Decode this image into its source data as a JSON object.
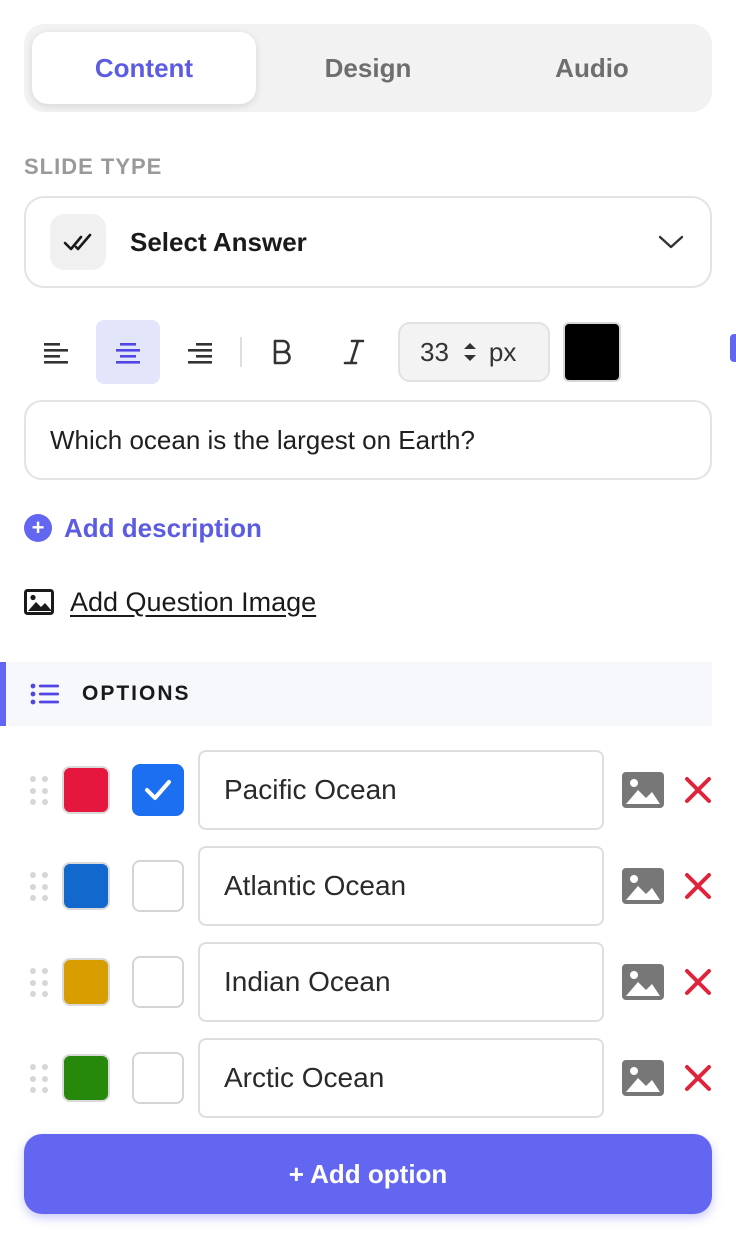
{
  "tabs": [
    {
      "label": "Content",
      "active": true
    },
    {
      "label": "Design",
      "active": false
    },
    {
      "label": "Audio",
      "active": false
    }
  ],
  "slide_type": {
    "section_label": "SLIDE TYPE",
    "selected": "Select Answer",
    "icon": "double-check-icon"
  },
  "toolbar": {
    "align": "center",
    "font_size_value": "33",
    "font_size_unit": "px",
    "text_color": "#000000"
  },
  "question": {
    "text": "Which ocean is the largest on Earth?"
  },
  "actions": {
    "add_description": "Add description",
    "add_question_image": "Add Question Image"
  },
  "options": {
    "title": "OPTIONS",
    "items": [
      {
        "text": "Pacific Ocean",
        "color": "#e5173f",
        "correct": true
      },
      {
        "text": "Atlantic Ocean",
        "color": "#1368ce",
        "correct": false
      },
      {
        "text": "Indian Ocean",
        "color": "#d89e00",
        "correct": false
      },
      {
        "text": "Arctic Ocean",
        "color": "#26890c",
        "correct": false
      }
    ],
    "add_label": "+ Add option"
  },
  "colors": {
    "accent": "#6366f1",
    "checkbox_checked": "#1d6ff2",
    "delete": "#e0243a"
  }
}
